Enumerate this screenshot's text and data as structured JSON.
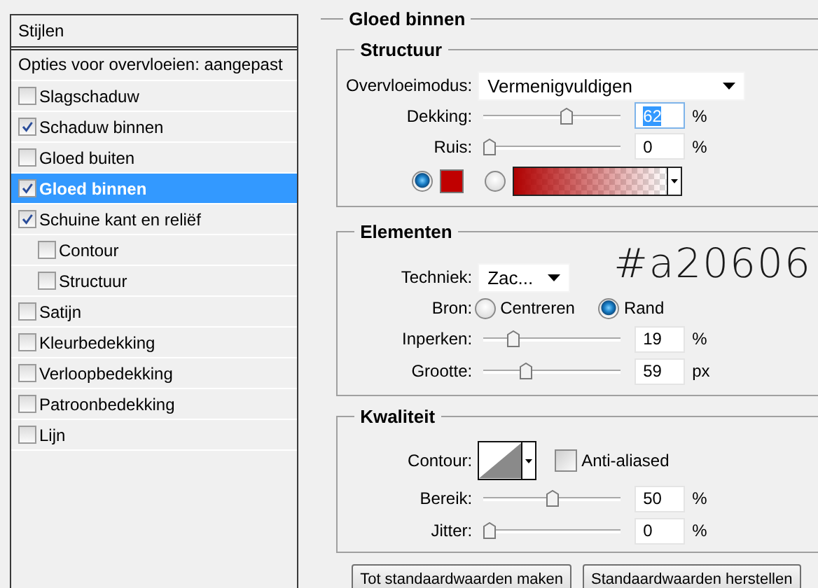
{
  "styles_list": {
    "header": "Stijlen",
    "blend_options": "Opties voor overvloeien: aangepast",
    "items": [
      {
        "label": "Slagschaduw",
        "checked": false,
        "selected": false
      },
      {
        "label": "Schaduw binnen",
        "checked": true,
        "selected": false
      },
      {
        "label": "Gloed buiten",
        "checked": false,
        "selected": false
      },
      {
        "label": "Gloed binnen",
        "checked": true,
        "selected": true
      },
      {
        "label": "Schuine kant en reliëf",
        "checked": true,
        "selected": false,
        "children": [
          {
            "label": "Contour",
            "checked": false,
            "selected": false
          },
          {
            "label": "Structuur",
            "checked": false,
            "selected": false
          }
        ]
      },
      {
        "label": "Satijn",
        "checked": false,
        "selected": false
      },
      {
        "label": "Kleurbedekking",
        "checked": false,
        "selected": false
      },
      {
        "label": "Verloopbedekking",
        "checked": false,
        "selected": false
      },
      {
        "label": "Patroonbedekking",
        "checked": false,
        "selected": false
      },
      {
        "label": "Lijn",
        "checked": false,
        "selected": false
      }
    ]
  },
  "panel": {
    "title": "Gloed binnen",
    "structure": {
      "title": "Structuur",
      "blend_mode": {
        "label": "Overvloeimodus:",
        "value": "Vermenigvuldigen"
      },
      "sliders": [
        {
          "label": "Dekking:",
          "level": 0.62,
          "value": "62",
          "unit": "%",
          "focused": true
        },
        {
          "label": "Ruis:",
          "level": 0,
          "value": "0",
          "unit": "%",
          "focused": false
        }
      ],
      "fill": [
        {
          "kind": "color",
          "selected": true,
          "color": "#c00000"
        },
        {
          "kind": "gradient",
          "selected": false
        }
      ]
    },
    "elements": {
      "title": "Elementen",
      "technique": {
        "label": "Techniek:",
        "value": "Zac..."
      },
      "source": {
        "label": "Bron:",
        "options": [
          {
            "label": "Centreren",
            "selected": false
          },
          {
            "label": "Rand",
            "selected": true
          }
        ]
      },
      "sliders": [
        {
          "label": "Inperken:",
          "level": 0.19,
          "value": "19",
          "unit": "%",
          "focused": false
        },
        {
          "label": "Grootte:",
          "level": 0.29,
          "value": "59",
          "unit": "px",
          "focused": false
        }
      ]
    },
    "quality": {
      "title": "Kwaliteit",
      "contour": {
        "label": "Contour:"
      },
      "anti_aliased": {
        "label": "Anti-aliased",
        "checked": false
      },
      "sliders": [
        {
          "label": "Bereik:",
          "level": 0.5,
          "value": "50",
          "unit": "%",
          "focused": false
        },
        {
          "label": "Jitter:",
          "level": 0,
          "value": "0",
          "unit": "%",
          "focused": false
        }
      ]
    }
  },
  "annotation": "#a20606",
  "buttons": [
    "Tot standaardwaarden maken",
    "Standaardwaarden herstellen"
  ]
}
